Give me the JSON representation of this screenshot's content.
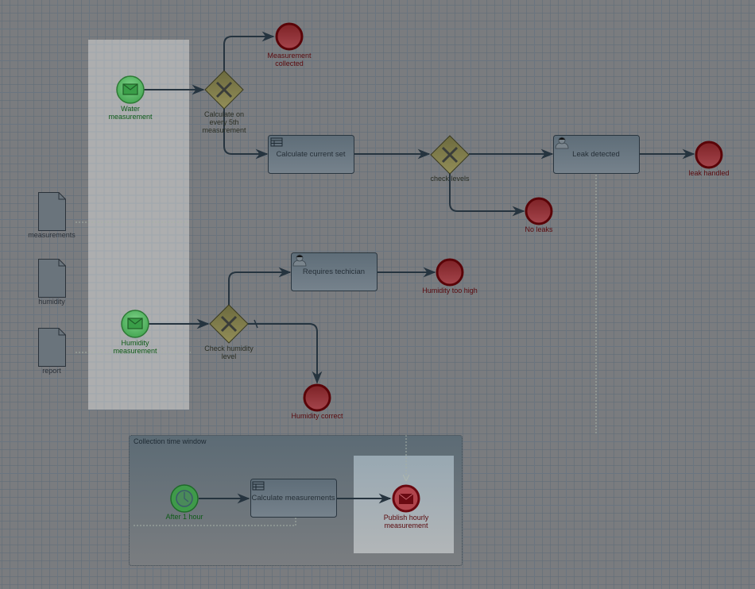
{
  "diagram": {
    "lane": {
      "name": "selection-lane"
    },
    "start_events": [
      {
        "id": "water",
        "label_lines": [
          "Water",
          "measurement"
        ],
        "icon": "envelope-icon",
        "type": "message-start"
      },
      {
        "id": "humidity",
        "label_lines": [
          "Humidity",
          "measurement"
        ],
        "icon": "envelope-icon",
        "type": "message-start"
      },
      {
        "id": "timer",
        "label_lines": [
          "After 1 hour"
        ],
        "icon": "clock-icon",
        "type": "timer-start"
      }
    ],
    "gateways": [
      {
        "id": "gw_every5",
        "label_lines": [
          "Calculate on",
          "every 5th",
          "measurement"
        ],
        "type": "exclusive"
      },
      {
        "id": "gw_levels",
        "label_lines": [
          "check levels"
        ],
        "type": "exclusive"
      },
      {
        "id": "gw_humidity",
        "label_lines": [
          "Check humidity",
          "level"
        ],
        "type": "exclusive"
      }
    ],
    "tasks": [
      {
        "id": "calc_current",
        "label": "Calculate current set",
        "icon": "business-rule-icon"
      },
      {
        "id": "leak_detected",
        "label": "Leak detected",
        "icon": "user-icon"
      },
      {
        "id": "requires_tech",
        "label": "Requires techician",
        "icon": "user-icon"
      },
      {
        "id": "calc_measurements",
        "label": "Calculate measurements",
        "icon": "business-rule-icon"
      }
    ],
    "end_events": [
      {
        "id": "measurement_collected",
        "label_lines": [
          "Measurement",
          "collected"
        ]
      },
      {
        "id": "leak_handled",
        "label_lines": [
          "leak handled"
        ]
      },
      {
        "id": "no_leaks",
        "label_lines": [
          "No leaks"
        ]
      },
      {
        "id": "humidity_high",
        "label_lines": [
          "Humidity too high"
        ]
      },
      {
        "id": "humidity_correct",
        "label_lines": [
          "Humidity correct"
        ]
      },
      {
        "id": "publish_hourly",
        "label_lines": [
          "Publish hourly",
          "measurement"
        ],
        "icon": "envelope-icon",
        "type": "message-end"
      }
    ],
    "data_objects": [
      {
        "id": "measurements",
        "label": "measurements"
      },
      {
        "id": "humidity_data",
        "label": "humidity"
      },
      {
        "id": "report",
        "label": "report"
      }
    ],
    "subprocess": {
      "label": "Collection time window"
    },
    "colors": {
      "start_fill": "#4caf5a",
      "start_stroke": "#2d7a35",
      "end_fill": "#8a2a30",
      "end_stroke": "#5a0408",
      "gateway_fill": "#8a8550",
      "gateway_stroke": "#3a3a20",
      "task_fill": "#6a7884",
      "task_stroke": "#2a3640"
    }
  }
}
